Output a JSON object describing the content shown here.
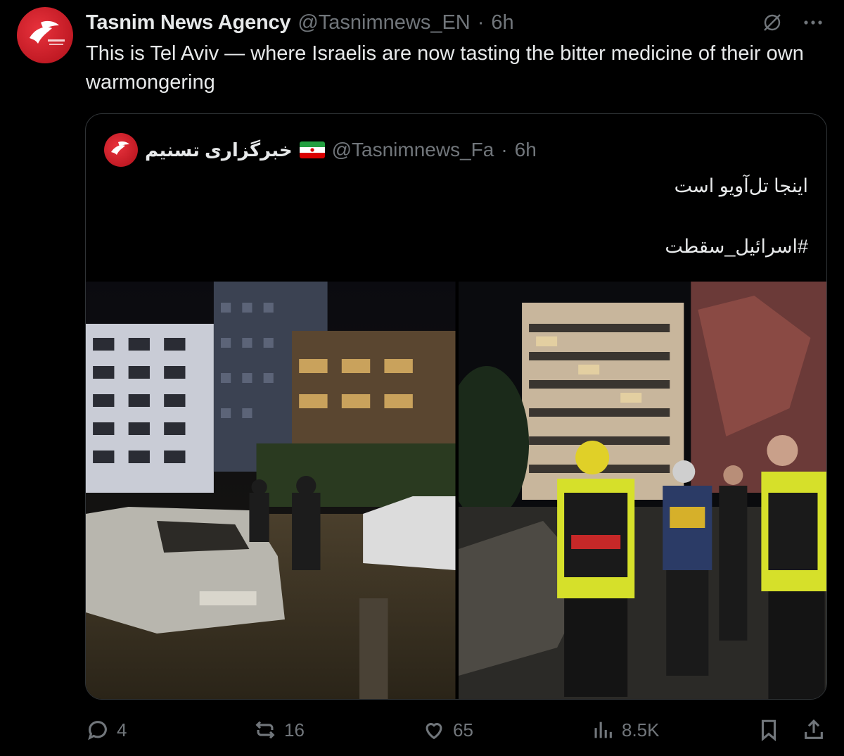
{
  "tweet": {
    "author_name": "Tasnim News Agency",
    "author_handle": "@Tasnimnews_EN",
    "separator": "·",
    "time": "6h",
    "text": "This is Tel Aviv — where Israelis are now tasting the bitter medicine of their own warmongering"
  },
  "quote": {
    "author_name": "خبرگزاری تسنیم",
    "author_handle": "@Tasnimnews_Fa",
    "separator": "·",
    "time": "6h",
    "line1": "اینجا تل‌آویو است",
    "line2": "#اسرائیل_سقطت"
  },
  "icons": {
    "grok": "grok-icon",
    "more": "more-icon",
    "reply": "reply-icon",
    "retweet": "retweet-icon",
    "like": "heart-icon",
    "views": "views-icon",
    "bookmark": "bookmark-icon",
    "share": "share-icon"
  },
  "actions": {
    "replies": "4",
    "retweets": "16",
    "likes": "65",
    "views": "8.5K"
  },
  "colors": {
    "background": "#000000",
    "text": "#e7e9ea",
    "muted": "#71767b",
    "border": "#2f3336",
    "brand_red": "#d7202b"
  }
}
